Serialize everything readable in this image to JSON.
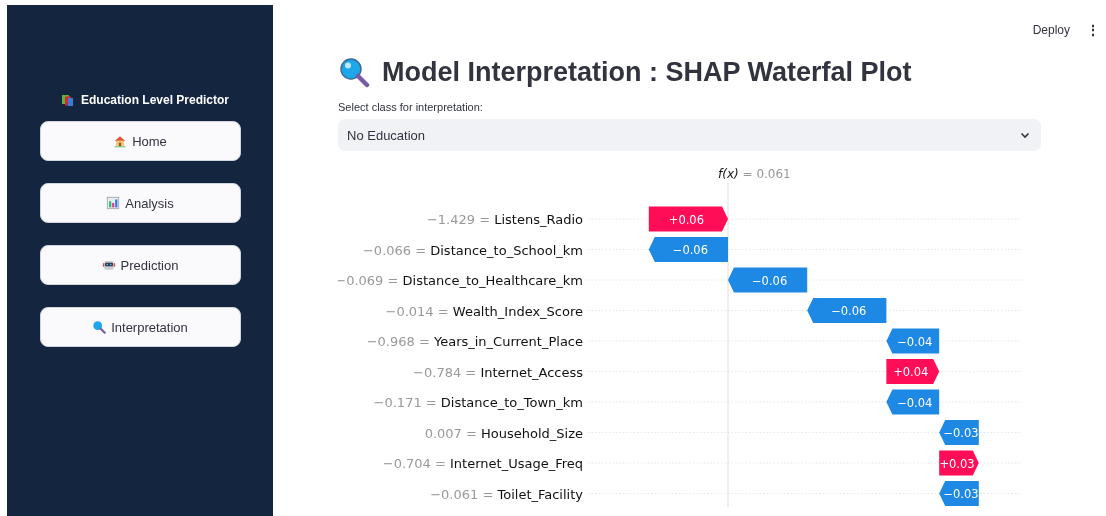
{
  "top_bar": {
    "deploy": "Deploy",
    "menu": "⋮"
  },
  "sidebar": {
    "title": "Education Level Predictor",
    "items": [
      {
        "label": "Home"
      },
      {
        "label": "Analysis"
      },
      {
        "label": "Prediction"
      },
      {
        "label": "Interpretation"
      }
    ]
  },
  "main": {
    "title": "Model Interpretation : SHAP Waterfal Plot",
    "select": {
      "label": "Select class for interpretation:",
      "value": "No Education"
    },
    "waterfall": {
      "output_label": "f(x)",
      "output_value": "= 0.061",
      "rows": [
        {
          "feature_value": "−1.429 =",
          "feature": "Listens_Radio",
          "contribution": "+0.06",
          "kind": "positive"
        },
        {
          "feature_value": "−0.066 =",
          "feature": "Distance_to_School_km",
          "contribution": "−0.06",
          "kind": "negative"
        },
        {
          "feature_value": "−0.069 =",
          "feature": "Distance_to_Healthcare_km",
          "contribution": "−0.06",
          "kind": "negative"
        },
        {
          "feature_value": "−0.014 =",
          "feature": "Wealth_Index_Score",
          "contribution": "−0.06",
          "kind": "negative"
        },
        {
          "feature_value": "−0.968 =",
          "feature": "Years_in_Current_Place",
          "contribution": "−0.04",
          "kind": "negative"
        },
        {
          "feature_value": "−0.784 =",
          "feature": "Internet_Access",
          "contribution": "+0.04",
          "kind": "positive"
        },
        {
          "feature_value": "−0.171 =",
          "feature": "Distance_to_Town_km",
          "contribution": "−0.04",
          "kind": "negative"
        },
        {
          "feature_value": "0.007 =",
          "feature": "Household_Size",
          "contribution": "−0.03",
          "kind": "negative"
        },
        {
          "feature_value": "−0.704 =",
          "feature": "Internet_Usage_Freq",
          "contribution": "+0.03",
          "kind": "positive"
        },
        {
          "feature_value": "−0.061 =",
          "feature": "Toilet_Facility",
          "contribution": "−0.03",
          "kind": "negative"
        }
      ]
    }
  }
}
